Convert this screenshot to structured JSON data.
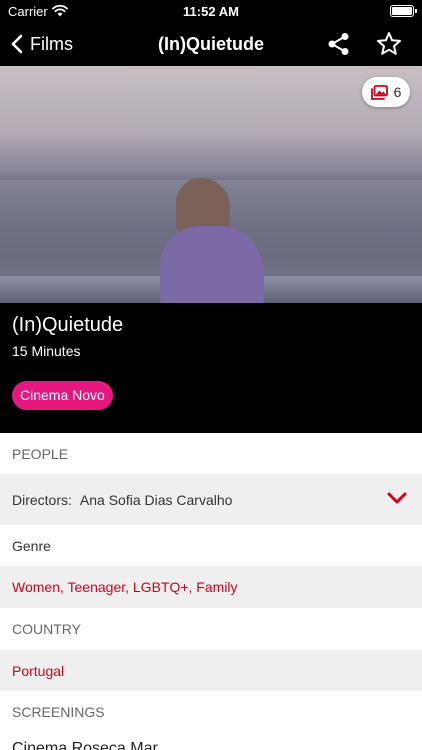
{
  "status": {
    "carrier": "Carrier",
    "time": "11:52 AM"
  },
  "nav": {
    "back_label": "Films",
    "title": "(In)Quietude",
    "accent": "#ffffff"
  },
  "hero": {
    "gallery_count": "6",
    "icons": [
      "photo-gallery-icon"
    ]
  },
  "film": {
    "title": "(In)Quietude",
    "duration": "15 Minutes",
    "tag": "Cinema Novo",
    "tag_color": "#e6187f"
  },
  "sections": {
    "people_header": "PEOPLE",
    "directors_label": "Directors:",
    "directors_value": "Ana Sofia Dias Carvalho",
    "genre_header": "Genre",
    "genre_value": "Women, Teenager, LGBTQ+, Family",
    "country_header": "COUNTRY",
    "country_value": "Portugal",
    "screenings_header": "SCREENINGS",
    "screening_partial": "Cinema Roseca Mar..."
  },
  "colors": {
    "link_red": "#d0021b",
    "row_gray": "#efefef"
  }
}
